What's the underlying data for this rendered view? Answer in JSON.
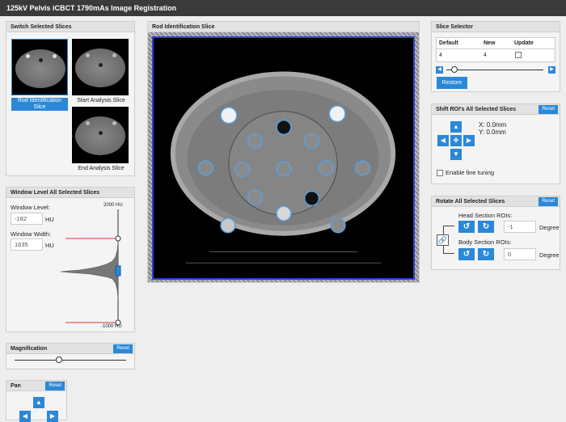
{
  "app": {
    "title": "125kV Pelvis iCBCT 1790mAs Image Registration"
  },
  "switch": {
    "title": "Switch Selected Slices",
    "slices": [
      {
        "caption": "Rod Identification Slice"
      },
      {
        "caption": "Start Analysis Slice"
      },
      {
        "caption": "End Analysis Slice"
      }
    ]
  },
  "window": {
    "title": "Window Level All Selected Slices",
    "level_label": "Window Level:",
    "level_value": "-182",
    "level_unit": "HU",
    "width_label": "Window Width:",
    "width_value": "1635",
    "width_unit": "HU",
    "top_label": "2000 HU",
    "bottom_label": "-1000 HU"
  },
  "magnification": {
    "title": "Magnification",
    "reset": "Reset",
    "level": 0.4
  },
  "pan": {
    "title": "Pan",
    "reset": "Reset"
  },
  "viewer": {
    "title": "Rod Identification Slice"
  },
  "selector": {
    "title": "Slice Selector",
    "col_default": "Default",
    "col_new": "New",
    "col_update": "Update",
    "default_val": "4",
    "new_val": "4",
    "restore": "Restore"
  },
  "shift": {
    "title": "Shift ROI's All Selected Slices",
    "reset": "Reset",
    "x": "X: 0.0mm",
    "y": "Y: 0.0mm",
    "fine": "Enable fine tuning"
  },
  "rotate": {
    "title": "Rotate All Selected Slices",
    "reset": "Reset",
    "head_label": "Head Section ROIs:",
    "head_value": "-1",
    "head_unit": "Degrees",
    "body_label": "Body Section ROIs:",
    "body_value": "0",
    "body_unit": "Degrees"
  },
  "colors": {
    "accent": "#2b88d8",
    "titlebar": "#3a3a3a"
  }
}
